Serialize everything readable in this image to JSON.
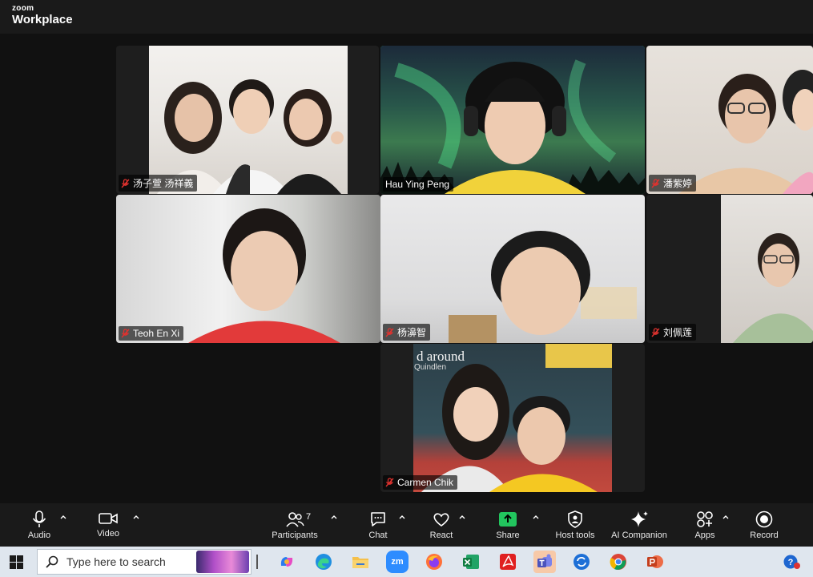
{
  "brand": {
    "small": "zoom",
    "big": "Workplace"
  },
  "participants": [
    {
      "name": "汤子萱 汤祥義",
      "muted": true,
      "active": false
    },
    {
      "name": "Hau Ying Peng",
      "muted": false,
      "active": true
    },
    {
      "name": "潘紫婷",
      "muted": true,
      "active": false
    },
    {
      "name": "Teoh En Xi",
      "muted": true,
      "active": false
    },
    {
      "name": "杨濞智",
      "muted": true,
      "active": false
    },
    {
      "name": "刘佩莲",
      "muted": true,
      "active": false
    },
    {
      "name": "Carmen Chik",
      "muted": true,
      "active": false
    }
  ],
  "overlay_text": {
    "line1": "d around",
    "line2": "Quindlen"
  },
  "toolbar": {
    "audio": "Audio",
    "video": "Video",
    "participants": "Participants",
    "participants_count": "7",
    "chat": "Chat",
    "react": "React",
    "share": "Share",
    "host_tools": "Host tools",
    "ai_companion": "AI Companion",
    "apps": "Apps",
    "record": "Record"
  },
  "taskbar": {
    "search_placeholder": "Type here to search",
    "apps": [
      "start-icon",
      "copilot-icon",
      "edge-icon",
      "file-explorer-icon",
      "zoom-icon",
      "firefox-icon",
      "excel-icon",
      "acrobat-icon",
      "teams-icon",
      "outlook-icon",
      "chrome-icon",
      "powerpoint-icon"
    ],
    "zoom_label": "zm"
  },
  "colors": {
    "active_speaker": "#2bd36b",
    "share_green": "#22c55e",
    "muted_red": "#e0322f"
  }
}
